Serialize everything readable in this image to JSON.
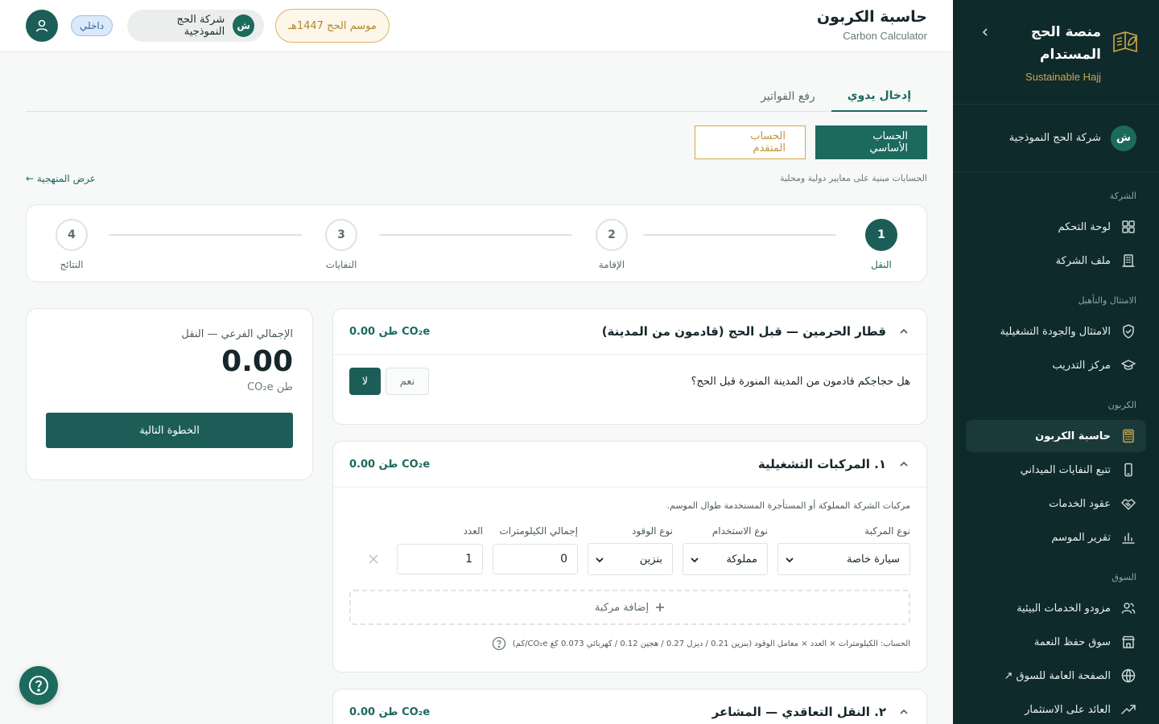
{
  "sidebar": {
    "brand_title": "منصة الحج المستدام",
    "brand_sub": "Sustainable Hajj",
    "company_initial": "ش",
    "company_name": "شركة الحج النموذجية",
    "sections": [
      {
        "title": "الشركة",
        "items": [
          {
            "label": "لوحة التحكم",
            "icon": "dashboard-icon"
          },
          {
            "label": "ملف الشركة",
            "icon": "building-icon"
          }
        ]
      },
      {
        "title": "الامتثال والتأهيل",
        "items": [
          {
            "label": "الامتثال والجودة التشغيلية",
            "icon": "shield-check-icon"
          },
          {
            "label": "مركز التدريب",
            "icon": "graduation-cap-icon"
          }
        ]
      },
      {
        "title": "الكربون",
        "items": [
          {
            "label": "حاسبة الكربون",
            "icon": "calculator-icon",
            "active": true
          },
          {
            "label": "تتبع النفايات الميداني",
            "icon": "phone-icon"
          },
          {
            "label": "عقود الخدمات",
            "icon": "handshake-icon"
          },
          {
            "label": "تقرير الموسم",
            "icon": "bar-chart-icon"
          }
        ]
      },
      {
        "title": "السوق",
        "items": [
          {
            "label": "مزودو الخدمات البيئية",
            "icon": "users-icon"
          },
          {
            "label": "سوق حفظ النعمة",
            "icon": "store-icon"
          },
          {
            "label": "الصفحة العامة للسوق ↗",
            "icon": "globe-icon"
          },
          {
            "label": "العائد على الاستثمار",
            "icon": "trending-up-icon"
          }
        ]
      }
    ]
  },
  "header": {
    "title": "حاسبة الكربون",
    "subtitle": "Carbon Calculator",
    "season": "موسم الحج 1447هـ",
    "company_initial": "ش",
    "company_name": "شركة الحج النموذجية",
    "badge": "داخلي"
  },
  "tabs": [
    "إدخال يدوي",
    "رفع الفواتير"
  ],
  "modes": {
    "basic": "الحساب الأساسي",
    "advanced": "الحساب المتقدم"
  },
  "standards_note": "الحسابات مبنية على معايير دولية ومحلية",
  "methodology_link": "عرض المنهجية ←",
  "steps": [
    {
      "num": "1",
      "label": "النقل"
    },
    {
      "num": "2",
      "label": "الإقامة"
    },
    {
      "num": "3",
      "label": "النفايات"
    },
    {
      "num": "4",
      "label": "النتائج"
    }
  ],
  "summary": {
    "label": "الإجمالي الفرعي — النقل",
    "value": "0.00",
    "unit": "طن CO₂e",
    "next": "الخطوة التالية"
  },
  "train": {
    "title": "قطار الحرمين — قبل الحج (قادمون من المدينة)",
    "total": "0.00 طن CO₂e",
    "question": "هل حجاجكم قادمون من المدينة المنورة قبل الحج؟",
    "yes": "نعم",
    "no": "لا"
  },
  "vehicles": {
    "title": "١. المركبات التشغيلية",
    "total": "0.00 طن CO₂e",
    "desc": "مركبات الشركة المملوكة أو المستأجرة المستخدمة طوال الموسم.",
    "labels": {
      "type": "نوع المركبة",
      "usage": "نوع الاستخدام",
      "fuel": "نوع الوقود",
      "km": "إجمالي الكيلومترات",
      "count": "العدد"
    },
    "row": {
      "type": "سيارة خاصة",
      "usage": "مملوكة",
      "fuel": "بنزين",
      "km": "0",
      "count": "1"
    },
    "add": "إضافة مركبة",
    "formula": "الحساب: الكيلومترات × العدد × معامل الوقود (بنزين 0.21 / ديزل 0.27 / هجين 0.12 / كهربائي 0.073 كغ CO₂e/كم)"
  },
  "contracted": {
    "title": "٢. النقل التعاقدي — المشاعر",
    "total": "0.00 طن CO₂e"
  },
  "colors": {
    "primary": "#1c6a5e",
    "sidebar": "#0f2a2a",
    "gold": "#d0a64a"
  }
}
